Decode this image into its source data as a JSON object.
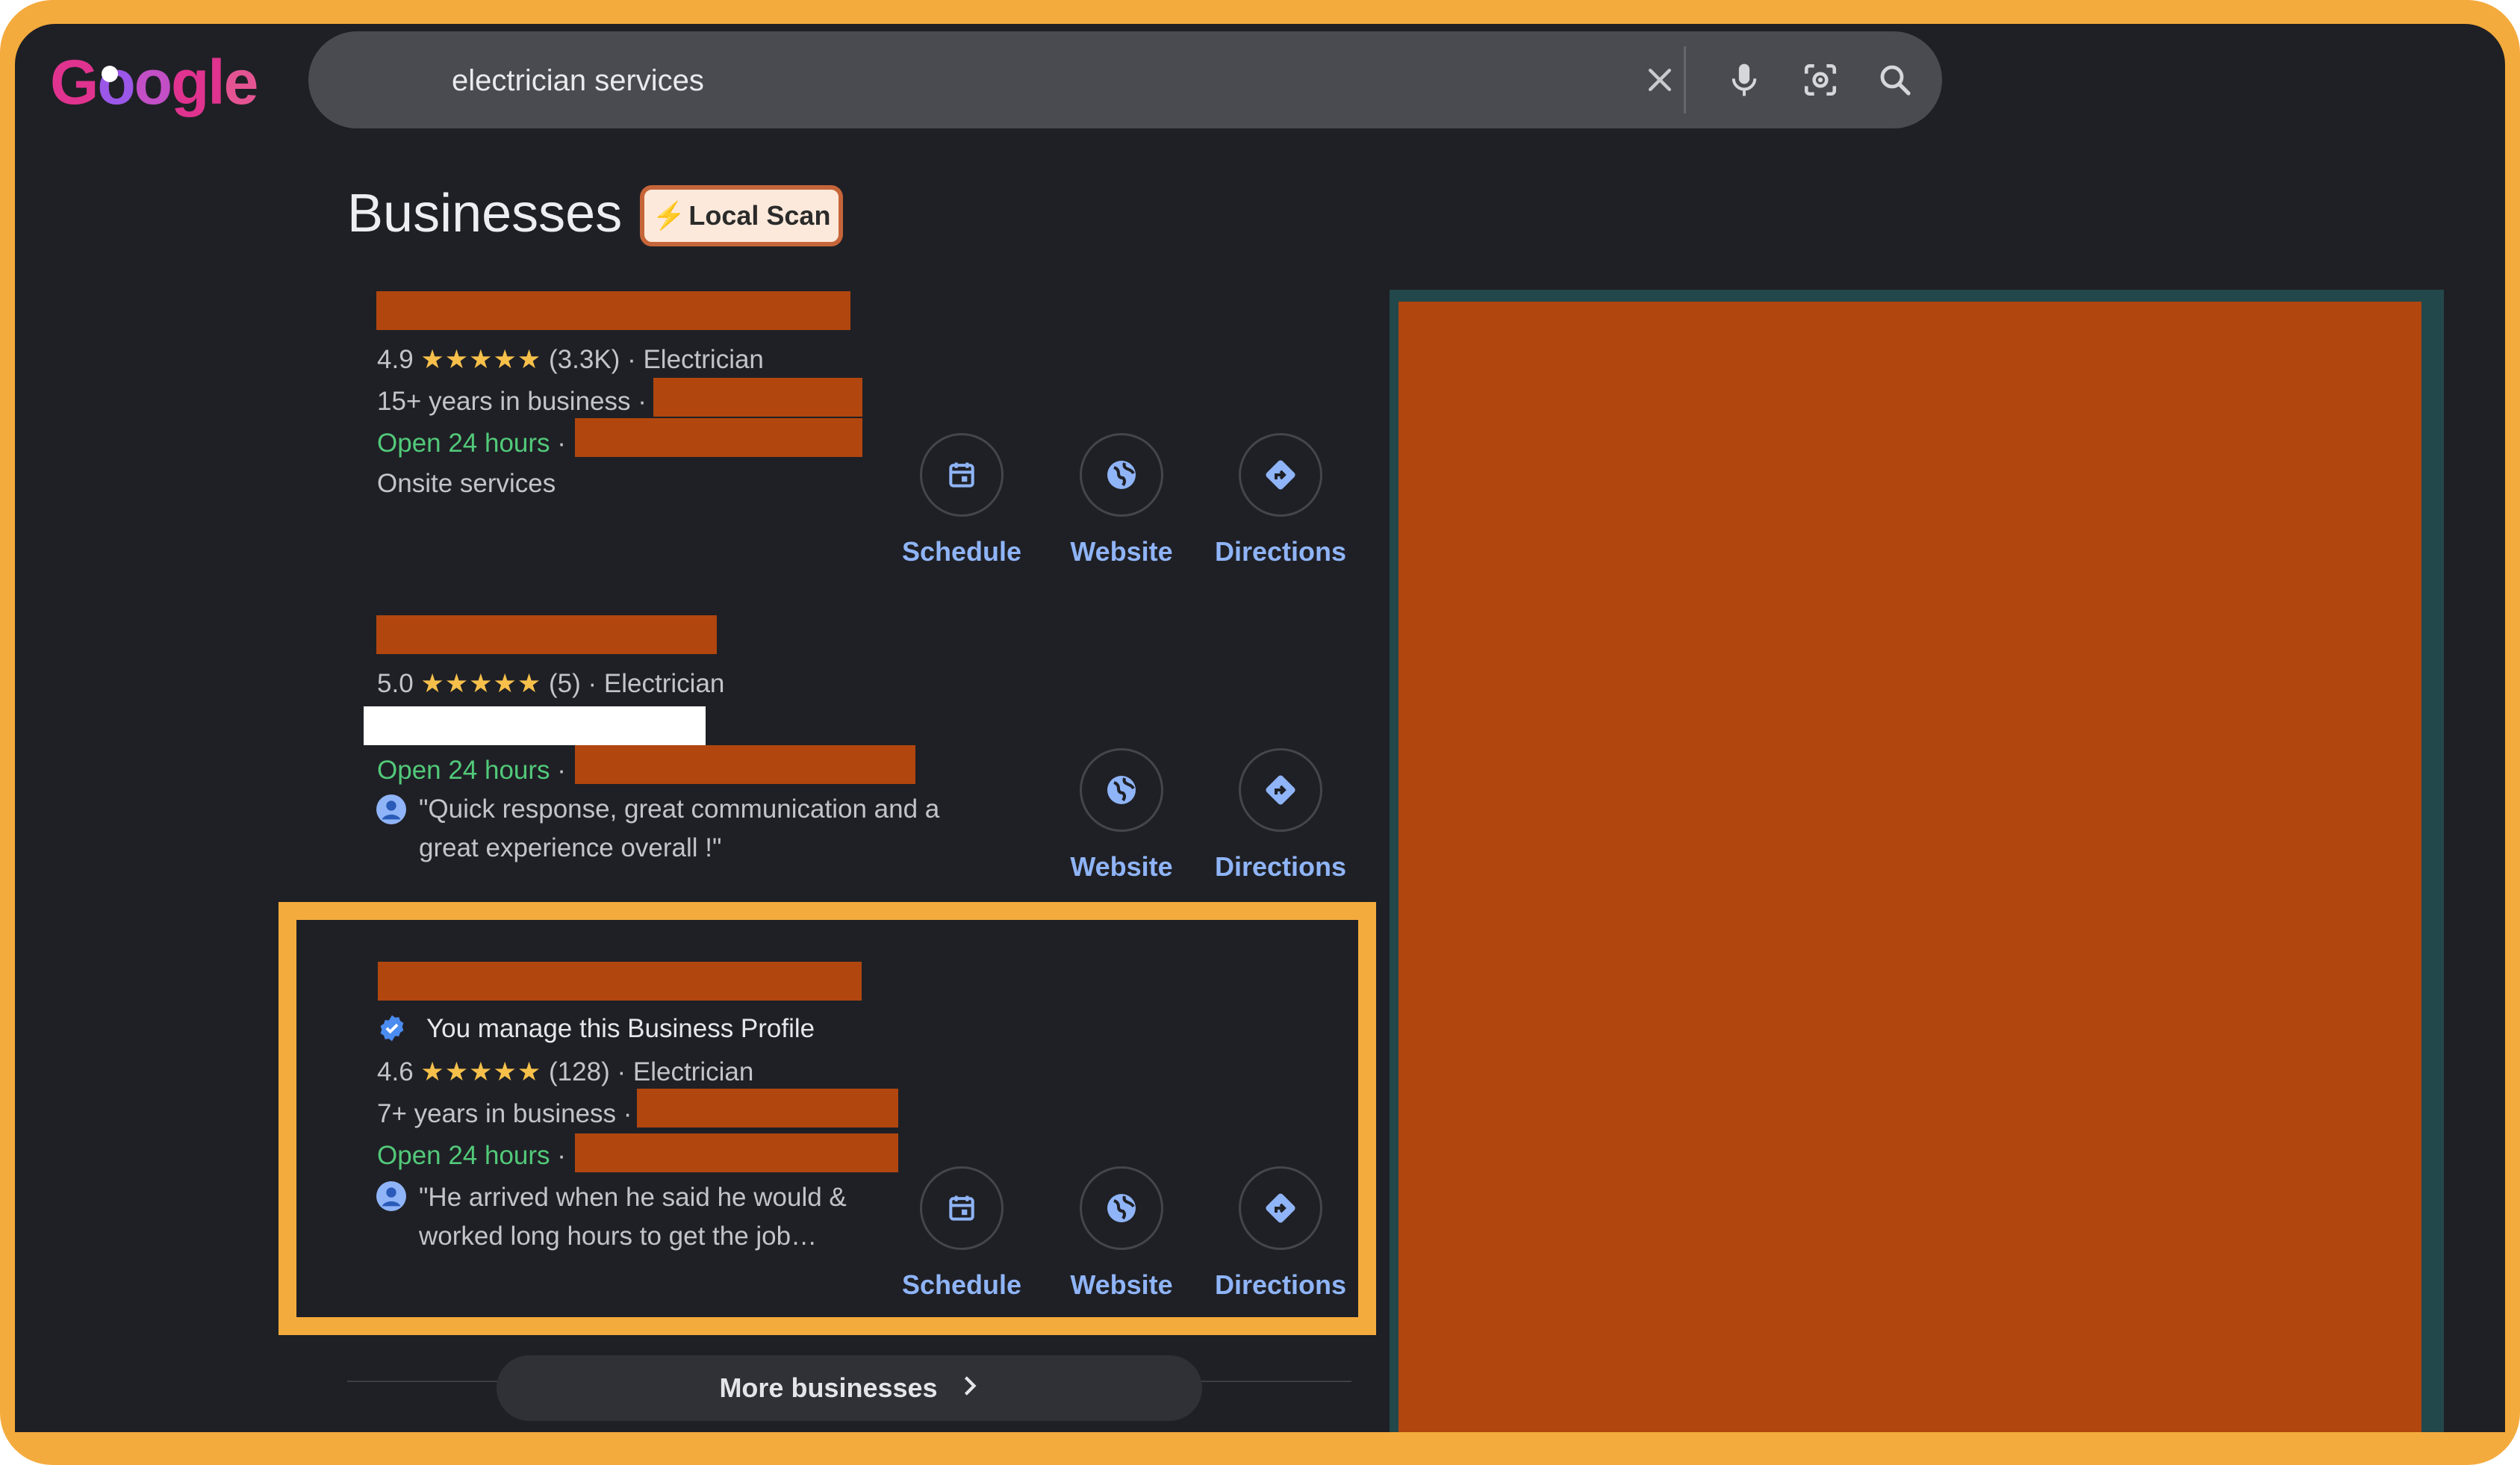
{
  "logo": {
    "text": "Google"
  },
  "search": {
    "query": "electrician services",
    "clear_icon": "close-icon",
    "voice_icon": "microphone-icon",
    "lens_icon": "camera-lens-icon",
    "search_icon": "search-icon"
  },
  "businesses": {
    "heading": "Businesses",
    "badge": "Local Scan",
    "badge_icon": "lightning-icon"
  },
  "listings": [
    {
      "rating": "4.9",
      "stars": "★★★★★",
      "reviews": "(3.3K)",
      "category": "Electrician",
      "years": "15+ years in business ·",
      "hours": "Open 24 hours",
      "hours_sep": "·",
      "extra": "Onsite services",
      "actions": [
        "Schedule",
        "Website",
        "Directions"
      ]
    },
    {
      "rating": "5.0",
      "stars": "★★★★★",
      "reviews": "(5)",
      "category": "Electrician",
      "hours": "Open 24 hours",
      "hours_sep": "·",
      "review_line1": "\"Quick response, great communication and a",
      "review_line2": "great experience overall !\"",
      "actions": [
        "Website",
        "Directions"
      ]
    },
    {
      "verified_text": "You manage this Business Profile",
      "rating": "4.6",
      "stars": "★★★★★",
      "reviews": "(128)",
      "category": "Electrician",
      "years": "7+ years in business ·",
      "hours": "Open 24 hours",
      "hours_sep": "·",
      "review_line1": "\"He arrived when he said he would &",
      "review_line2": "worked long hours to get the job…",
      "actions": [
        "Schedule",
        "Website",
        "Directions"
      ]
    }
  ],
  "more": {
    "label": "More businesses"
  },
  "colors": {
    "frame": "#f4ab3d",
    "background": "#1f2025",
    "redaction": "#b1460f",
    "link": "#8fb4f7",
    "open": "#52c97a",
    "star": "#f6c04b"
  }
}
